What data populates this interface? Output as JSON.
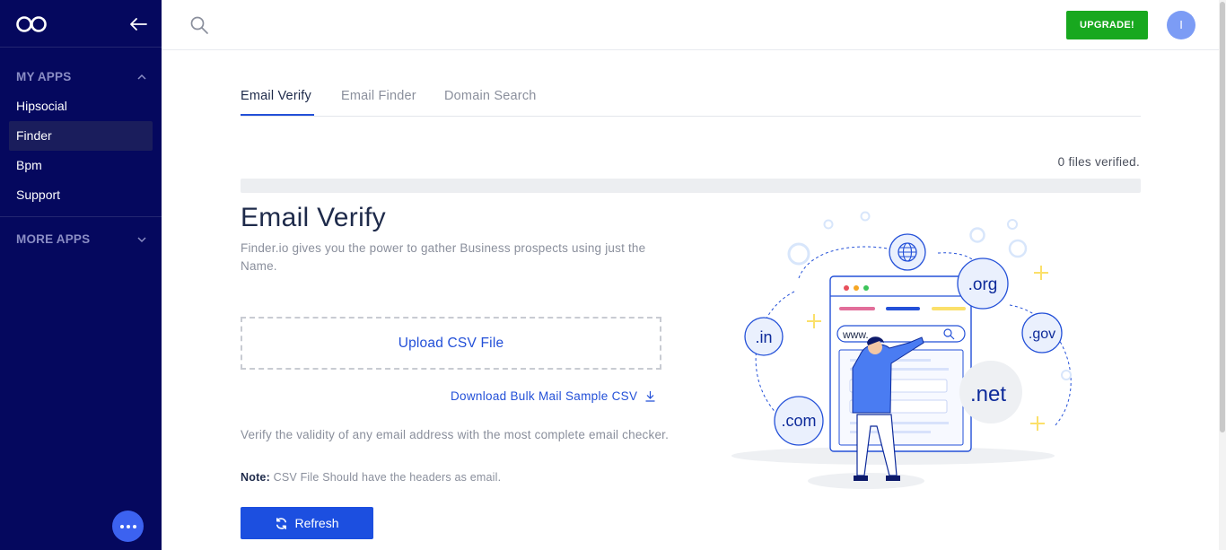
{
  "sidebar": {
    "my_apps_label": "MY APPS",
    "items": [
      {
        "label": "Hipsocial"
      },
      {
        "label": "Finder"
      },
      {
        "label": "Bpm"
      },
      {
        "label": "Support"
      }
    ],
    "more_apps_label": "MORE APPS",
    "active_item": "Finder"
  },
  "topbar": {
    "upgrade_label": "UPGRADE!",
    "avatar_initial": "I"
  },
  "tabs": [
    {
      "label": "Email Verify",
      "active": true
    },
    {
      "label": "Email Finder",
      "active": false
    },
    {
      "label": "Domain Search",
      "active": false
    }
  ],
  "status": {
    "files_verified": "0 files verified.",
    "progress": 0
  },
  "main": {
    "title": "Email Verify",
    "subtitle": "Finder.io gives you the power to gather Business prospects using just the Name.",
    "upload_label": "Upload CSV File",
    "download_label": "Download Bulk Mail Sample CSV",
    "description": "Verify the validity of any email address with the most complete email checker.",
    "note_label": "Note:",
    "note_text": " CSV File Should have the headers as email.",
    "refresh_label": "Refresh"
  },
  "illustration": {
    "domains": [
      ".org",
      ".in",
      ".gov",
      ".net",
      ".com"
    ],
    "address_text": "www."
  },
  "colors": {
    "sidebar_bg": "#05085e",
    "accent": "#2350d8",
    "upgrade": "#18a81f",
    "avatar": "#7c9cf5"
  },
  "icons": [
    "infinity-logo-icon",
    "arrow-left-icon",
    "chevron-up-icon",
    "chevron-down-icon",
    "search-icon",
    "download-icon",
    "refresh-icon",
    "more-dots-icon",
    "globe-icon"
  ]
}
